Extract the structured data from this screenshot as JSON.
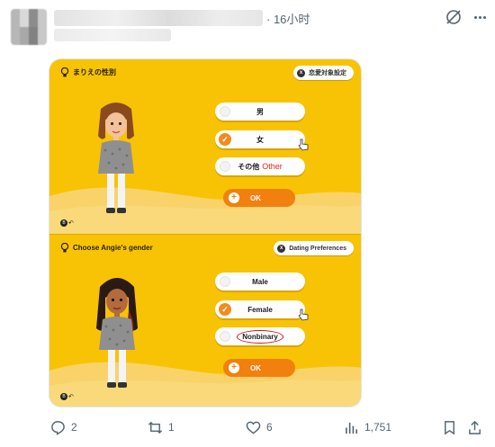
{
  "post": {
    "time": "· 16小时"
  },
  "panel_jp": {
    "title": "まりえの性別",
    "pref_button": "恋愛対象設定",
    "options": [
      {
        "label": "男",
        "selected": false
      },
      {
        "label": "女",
        "selected": true
      },
      {
        "label": "その他",
        "annotation": "Other",
        "selected": false
      }
    ],
    "ok": "OK"
  },
  "panel_en": {
    "title": "Choose Angie's gender",
    "pref_button": "Dating Preferences",
    "options": [
      {
        "label": "Male",
        "selected": false
      },
      {
        "label": "Female",
        "selected": true
      },
      {
        "label": "Nonbinary",
        "selected": false,
        "circled": true
      }
    ],
    "ok": "OK"
  },
  "actions": {
    "replies": "2",
    "reposts": "1",
    "likes": "6",
    "views": "1,751"
  },
  "colors": {
    "panel_bg": "#f7c304",
    "accent_orange": "#f2800e",
    "annotation_red": "#e8241a"
  },
  "icons": [
    "grok-icon",
    "more-icon",
    "reply-icon",
    "repost-icon",
    "like-icon",
    "views-icon",
    "bookmark-icon",
    "share-icon"
  ]
}
